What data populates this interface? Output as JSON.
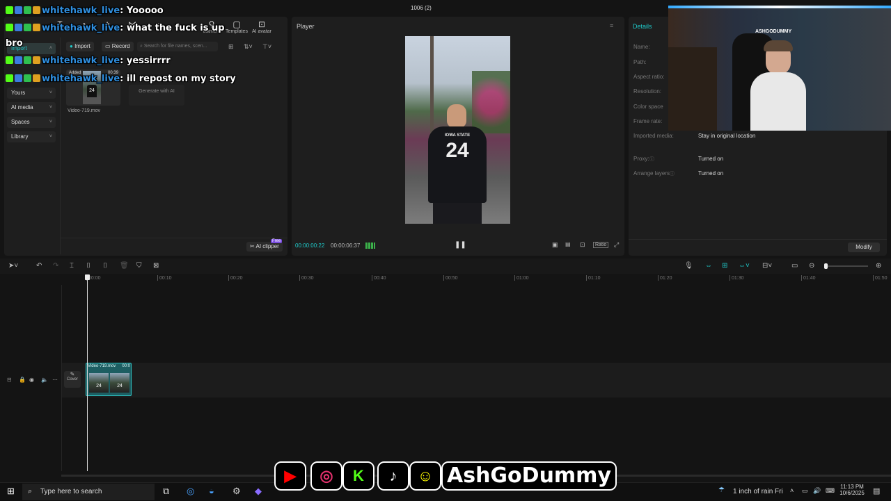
{
  "window": {
    "title": "1006 (2)"
  },
  "toolbar": {
    "import_tab": "Import",
    "items": [
      {
        "label": "",
        "icon": "text-icon"
      },
      {
        "label": "",
        "icon": "sticker-icon"
      },
      {
        "label": "",
        "icon": "effects-icon"
      },
      {
        "label": "",
        "icon": "transition-icon"
      },
      {
        "label": "",
        "icon": "caption-icon"
      },
      {
        "label": "ustment",
        "icon": "adjustment-icon"
      },
      {
        "label": "Templates",
        "icon": "templates-icon"
      },
      {
        "label": "AI avatar",
        "icon": "ai-avatar-icon"
      }
    ]
  },
  "sidebar": {
    "items": [
      {
        "label": "Import"
      },
      {
        "label": "Yours"
      },
      {
        "label": "AI media"
      },
      {
        "label": "Spaces"
      },
      {
        "label": "Library"
      }
    ]
  },
  "media": {
    "import_label": "Import",
    "record_label": "Record",
    "search_placeholder": "Search for file names, scen...",
    "clip": {
      "badge": "Added",
      "duration": "00:39",
      "name": "Video-719.mov"
    },
    "generate_label": "Generate with AI",
    "ai_clipper_label": "AI clipper",
    "free_badge": "Free"
  },
  "player": {
    "title": "Player",
    "time_current": "00:00:00:22",
    "time_total": "00:00:06:37",
    "ratio_label": "Ratio",
    "jersey_text": "IOWA STATE",
    "jersey_number": "24"
  },
  "details": {
    "title": "Details",
    "rows": [
      {
        "key": "Name:",
        "value": ""
      },
      {
        "key": "Path:",
        "value": ""
      },
      {
        "key": "Aspect ratio:",
        "value": ""
      },
      {
        "key": "Resolution:",
        "value": ""
      },
      {
        "key": "Color space",
        "value": ""
      },
      {
        "key": "Frame rate:",
        "value": ""
      },
      {
        "key": "Imported media:",
        "value": "Stay in original location"
      },
      {
        "key": "Proxy:",
        "value": "Turned on"
      },
      {
        "key": "Arrange layers",
        "value": "Turned on"
      }
    ],
    "modify_label": "Modify"
  },
  "timeline": {
    "ticks": [
      "00:00",
      "00:10",
      "00:20",
      "00:30",
      "00:40",
      "00:50",
      "01:00",
      "01:10",
      "01:20",
      "01:30",
      "01:40",
      "01:50"
    ],
    "clip_name": "Video-719.mov",
    "clip_time": "00:0",
    "cover_label": "Cover",
    "frame_number": "24"
  },
  "chat": {
    "messages": [
      {
        "user": "whitehawk_live",
        "text": ": Yooooo"
      },
      {
        "user": "whitehawk_live",
        "text": ": what the fuck is up"
      },
      {
        "user": "",
        "text": "bro"
      },
      {
        "user": "whitehawk_live",
        "text": ": yessirrrr"
      },
      {
        "user": "whitehawk_live",
        "text": ": ill repost on my story"
      }
    ]
  },
  "webcam": {
    "wall_text": "ASHGODUMMY"
  },
  "brand": {
    "channel_name": "AshGoDummy"
  },
  "taskbar": {
    "search_placeholder": "Type here to search",
    "weather": "1 inch of rain Fri",
    "time": "11:13 PM",
    "date": "10/6/2025"
  },
  "colors": {
    "accent": "#1fc8c8",
    "chat_user": "#2f8fe0",
    "youtube": "#ff0000",
    "kick": "#53fc18",
    "snapchat": "#fffc00"
  }
}
